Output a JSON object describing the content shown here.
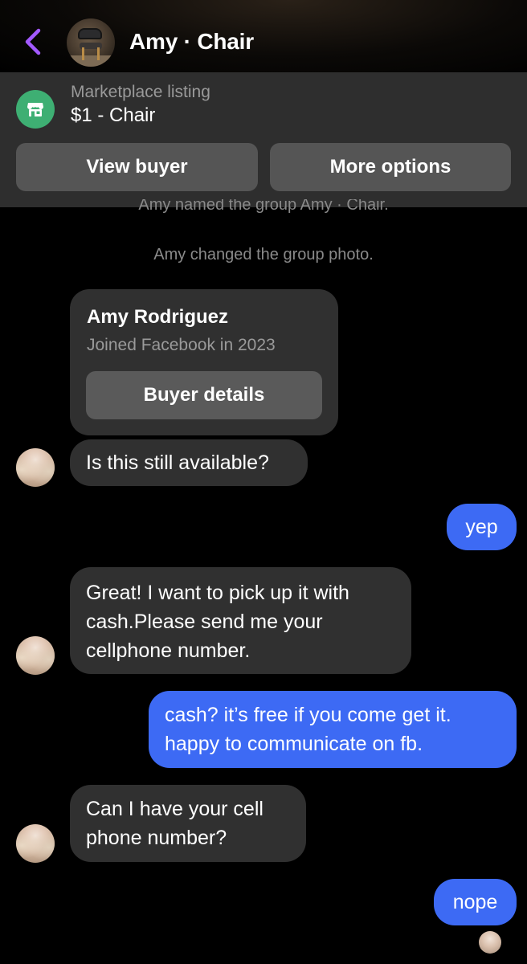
{
  "header": {
    "title": "Amy · Chair",
    "back_icon": "chevron-left-icon",
    "accent_color": "#a259ff"
  },
  "listing": {
    "label": "Marketplace listing",
    "title": "$1 - Chair",
    "icon": "marketplace-store-icon",
    "icon_color": "#3eaf73",
    "view_buyer_label": "View buyer",
    "more_options_label": "More options"
  },
  "system_messages": [
    "Amy named the group Amy · Chair.",
    "Amy changed the group photo."
  ],
  "buyer_card": {
    "name": "Amy Rodriguez",
    "joined": "Joined Facebook in 2023",
    "button_label": "Buyer details"
  },
  "messages": [
    {
      "sender": "them",
      "text": "Is this still available?"
    },
    {
      "sender": "me",
      "text": "yep"
    },
    {
      "sender": "them",
      "text": "Great! I want to pick up it with cash.Please send me your cellphone number."
    },
    {
      "sender": "me",
      "text": "cash? it’s free if you come get it. happy to communicate on fb."
    },
    {
      "sender": "them",
      "text": "Can I have your cell phone number?"
    },
    {
      "sender": "me",
      "text": "nope"
    }
  ],
  "colors": {
    "outgoing_bubble": "#3d6af4",
    "incoming_bubble": "#303030",
    "background": "#000000"
  }
}
